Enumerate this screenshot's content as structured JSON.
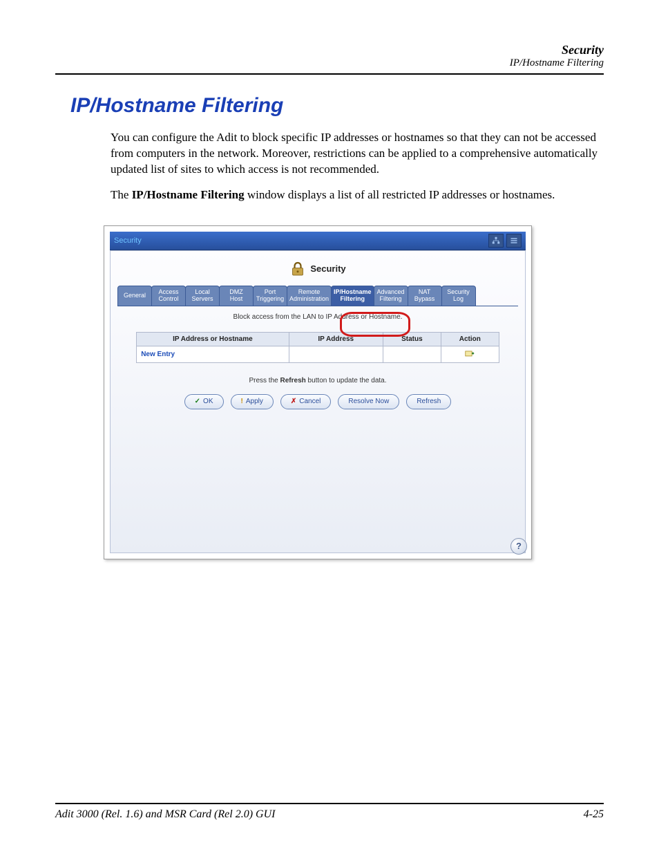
{
  "header": {
    "section": "Security",
    "subsection": "IP/Hostname Filtering"
  },
  "title": "IP/Hostname Filtering",
  "paragraphs": {
    "p1": "You can configure the Adit to block specific IP addresses or hostnames so that they can not be accessed from computers in the network. Moreover, restrictions can be applied to a comprehensive automatically updated list of sites to which access is not recommended.",
    "p2_pre": "The ",
    "p2_bold": "IP/Hostname Filtering",
    "p2_post": " window displays a list of all restricted IP addresses or hostnames."
  },
  "window": {
    "title": "Security",
    "panel_title": "Security",
    "tabs": [
      "General",
      "Access\nControl",
      "Local\nServers",
      "DMZ\nHost",
      "Port\nTriggering",
      "Remote\nAdministration",
      "IP/Hostname\nFiltering",
      "Advanced\nFiltering",
      "NAT\nBypass",
      "Security\nLog"
    ],
    "active_tab_index": 6,
    "instruction": "Block access from the LAN to IP Address or Hostname.",
    "table": {
      "headers": [
        "IP Address or Hostname",
        "IP Address",
        "Status",
        "Action"
      ],
      "new_entry_label": "New Entry"
    },
    "refresh_note_pre": "Press the ",
    "refresh_note_bold": "Refresh",
    "refresh_note_post": " button to update the data.",
    "buttons": {
      "ok": "OK",
      "apply": "Apply",
      "cancel": "Cancel",
      "resolve": "Resolve Now",
      "refresh": "Refresh"
    }
  },
  "footer": {
    "left": "Adit 3000 (Rel. 1.6) and MSR Card (Rel 2.0) GUI",
    "right": "4-25"
  }
}
